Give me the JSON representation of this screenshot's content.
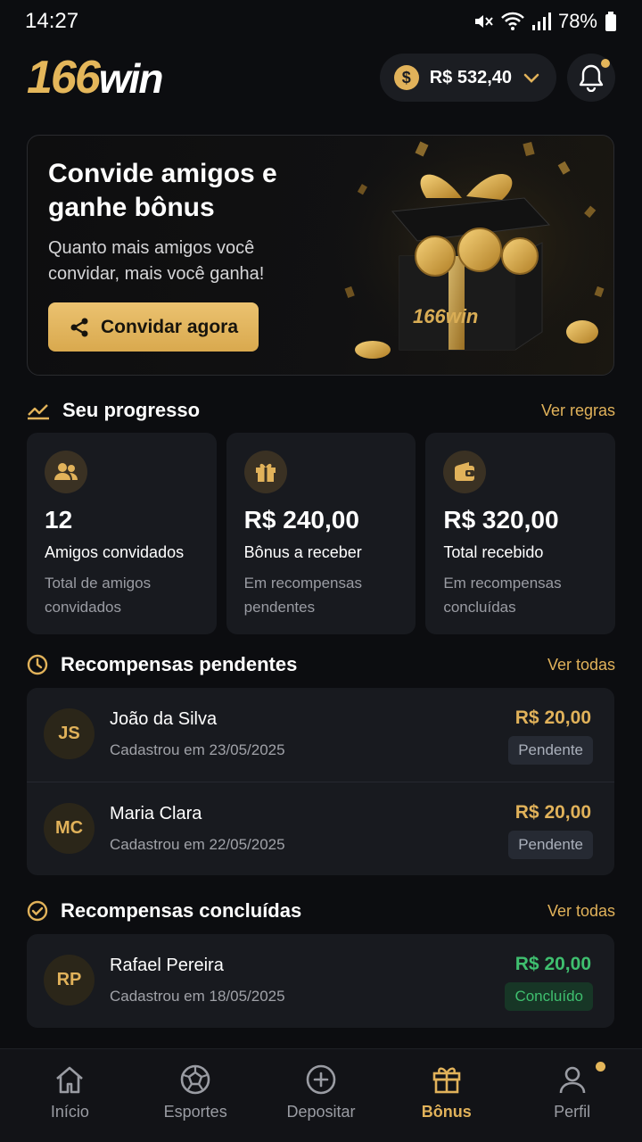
{
  "status_bar": {
    "time": "14:27",
    "battery": "78%"
  },
  "header": {
    "logo_number": "166",
    "logo_word": "win",
    "balance": "R$ 532,40",
    "coin_symbol": "$"
  },
  "banner": {
    "title": "Convide amigos e ganhe bônus",
    "subtitle": "Quanto mais amigos você convidar, mais você ganha!",
    "button_label": "Convidar agora",
    "box_logo": "166win"
  },
  "progress": {
    "title": "Seu progresso",
    "link": "Ver regras",
    "cards": [
      {
        "icon": "users-icon",
        "value": "12",
        "label": "Amigos convidados",
        "desc": "Total de amigos convidados"
      },
      {
        "icon": "gift-icon",
        "value": "R$ 240,00",
        "label": "Bônus a receber",
        "desc": "Em recompensas pendentes"
      },
      {
        "icon": "wallet-icon",
        "value": "R$ 320,00",
        "label": "Total recebido",
        "desc": "Em recompensas concluídas"
      }
    ]
  },
  "pending": {
    "title": "Recompensas pendentes",
    "link": "Ver todas",
    "items": [
      {
        "initials": "JS",
        "name": "João da Silva",
        "date": "Cadastrou em 23/05/2025",
        "amount": "R$ 20,00",
        "status": "Pendente"
      },
      {
        "initials": "MC",
        "name": "Maria Clara",
        "date": "Cadastrou em 22/05/2025",
        "amount": "R$ 20,00",
        "status": "Pendente"
      }
    ]
  },
  "completed": {
    "title": "Recompensas concluídas",
    "link": "Ver todas",
    "items": [
      {
        "initials": "RP",
        "name": "Rafael Pereira",
        "date": "Cadastrou em 18/05/2025",
        "amount": "R$ 20,00",
        "status": "Concluído"
      }
    ]
  },
  "nav": {
    "items": [
      {
        "icon": "home-icon",
        "label": "Início"
      },
      {
        "icon": "soccer-ball-icon",
        "label": "Esportes"
      },
      {
        "icon": "plus-circle-icon",
        "label": "Depositar"
      },
      {
        "icon": "gift-icon",
        "label": "Bônus"
      },
      {
        "icon": "user-icon",
        "label": "Perfil"
      }
    ],
    "active_index": 3
  },
  "colors": {
    "accent": "#e1b25a",
    "background": "#0c0d10",
    "card": "#181a1f",
    "success": "#3fbf6f"
  }
}
